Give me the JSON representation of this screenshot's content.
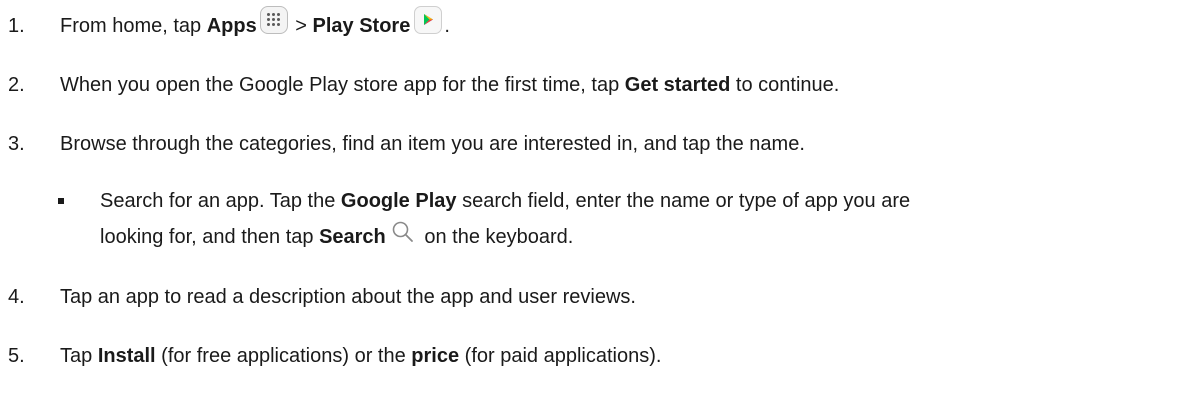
{
  "steps": [
    {
      "number": "1.",
      "parts": {
        "a": "From home, tap ",
        "b": "Apps",
        "c": " > ",
        "d": "Play Store",
        "e": "."
      }
    },
    {
      "number": "2.",
      "parts": {
        "a": "When you open the Google Play store app for the first time, tap ",
        "b": "Get started",
        "c": " to continue."
      }
    },
    {
      "number": "3.",
      "parts": {
        "a": "Browse through the categories, find an item you are interested in, and tap the name."
      }
    },
    {
      "number": "4.",
      "parts": {
        "a": "Tap an app to read a description about the app and user reviews."
      }
    },
    {
      "number": "5.",
      "parts": {
        "a": "Tap ",
        "b": "Install",
        "c": " (for free applications) or the ",
        "d": "price",
        "e": " (for paid applications)."
      }
    }
  ],
  "substep": {
    "line1": {
      "a": "Search for an app. Tap the ",
      "b": "Google Play",
      "c": " search field, enter the name or type of app you are"
    },
    "line2": {
      "a": "looking for, and then tap ",
      "b": "Search",
      "c": " on the keyboard."
    }
  },
  "icons": {
    "apps": "apps-grid-icon",
    "play_store": "play-store-icon",
    "search": "search-icon"
  },
  "colors": {
    "text": "#1a1a1a",
    "play_green": "#00c853",
    "play_blue": "#2196f3",
    "play_red": "#f44336",
    "play_yellow": "#ffc107",
    "search_stroke": "#8a8a8a"
  }
}
